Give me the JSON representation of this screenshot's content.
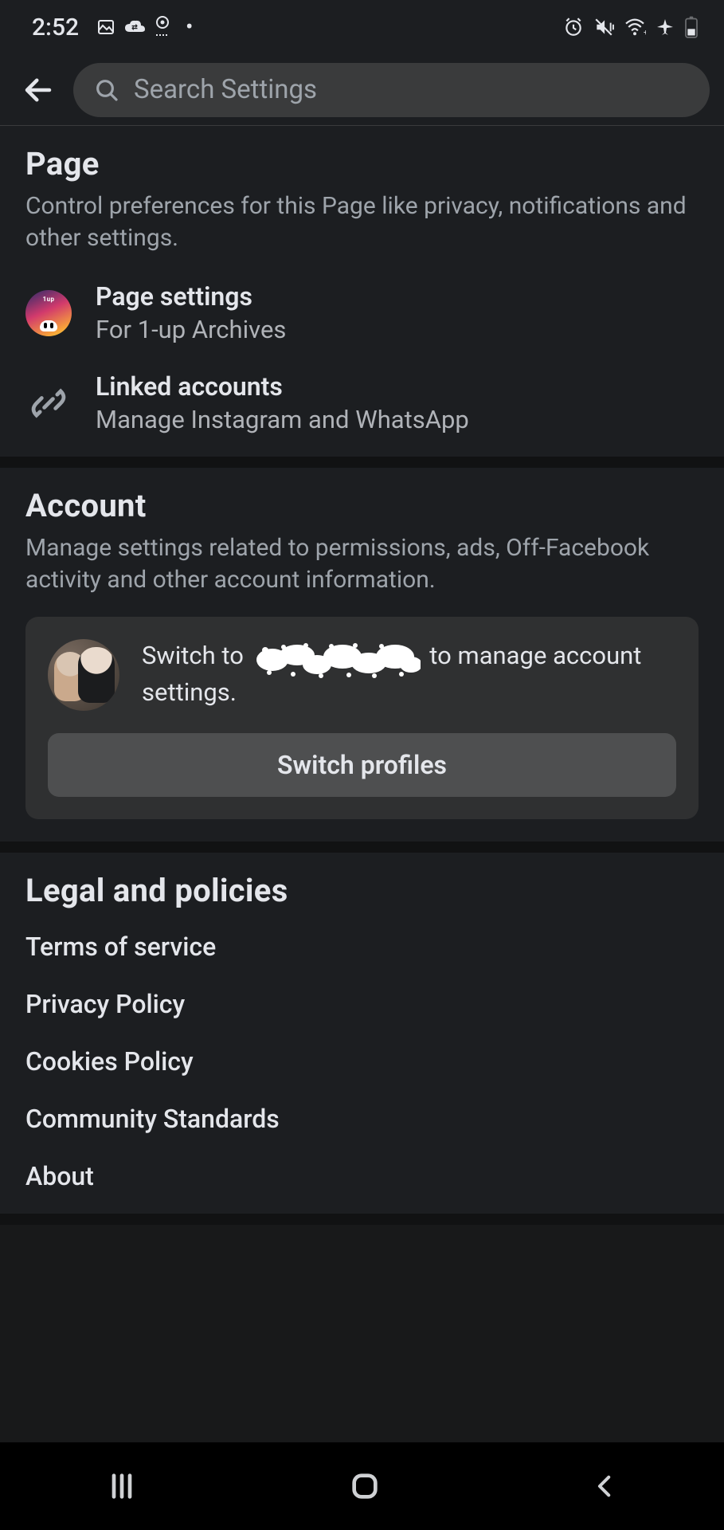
{
  "status": {
    "time": "2:52"
  },
  "header": {
    "search_placeholder": "Search Settings"
  },
  "page": {
    "title": "Page",
    "subtitle": "Control preferences for this Page like privacy, notifications and other settings.",
    "settings": {
      "label": "Page settings",
      "sub": "For 1-up Archives",
      "tag": "1up"
    },
    "linked": {
      "label": "Linked accounts",
      "sub": "Manage Instagram and WhatsApp"
    }
  },
  "account": {
    "title": "Account",
    "subtitle": "Manage settings related to permissions, ads, Off-Facebook activity and other account information.",
    "switch_prefix": "Switch to ",
    "switch_suffix": " to manage account settings.",
    "button": "Switch profiles"
  },
  "legal": {
    "title": "Legal and policies",
    "items": [
      "Terms of service",
      "Privacy Policy",
      "Cookies Policy",
      "Community Standards",
      "About"
    ]
  }
}
